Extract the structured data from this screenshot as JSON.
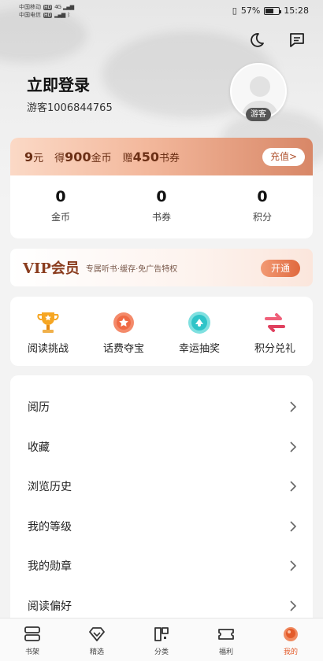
{
  "status_bar": {
    "carrier1": "中国移动",
    "carrier2": "中国电信",
    "hd": "HD",
    "signal": "4G",
    "battery": "57%",
    "time": "15:28"
  },
  "header": {
    "icons": [
      "moon-icon",
      "message-icon"
    ]
  },
  "profile": {
    "login_title": "立即登录",
    "guest_id": "游客1006844765",
    "avatar_badge": "游客"
  },
  "wallet": {
    "promo": {
      "price_num": "9",
      "price_unit": "元",
      "get_label": "得",
      "coins_num": "900",
      "coins_unit": "金币",
      "gift_label": "赠",
      "voucher_num": "450",
      "voucher_unit": "书券"
    },
    "recharge_label": "充值>",
    "stats": [
      {
        "value": "0",
        "label": "金币"
      },
      {
        "value": "0",
        "label": "书券"
      },
      {
        "value": "0",
        "label": "积分"
      }
    ]
  },
  "vip": {
    "title": "VIP会员",
    "subtitle": "专属听书·缓存·免广告特权",
    "button": "开通"
  },
  "activities": [
    {
      "label": "阅读挑战",
      "icon": "trophy-icon"
    },
    {
      "label": "话费夺宝",
      "icon": "medal-icon"
    },
    {
      "label": "幸运抽奖",
      "icon": "lottery-icon"
    },
    {
      "label": "积分兑礼",
      "icon": "exchange-icon"
    }
  ],
  "menu": [
    {
      "label": "阅历"
    },
    {
      "label": "收藏"
    },
    {
      "label": "浏览历史"
    },
    {
      "label": "我的等级"
    },
    {
      "label": "我的勋章"
    },
    {
      "label": "阅读偏好"
    }
  ],
  "nav": [
    {
      "label": "书架",
      "icon": "bookshelf-icon"
    },
    {
      "label": "精选",
      "icon": "diamond-icon"
    },
    {
      "label": "分类",
      "icon": "category-icon"
    },
    {
      "label": "福利",
      "icon": "ticket-icon"
    },
    {
      "label": "我的",
      "icon": "profile-icon"
    }
  ],
  "colors": {
    "accent": "#e35b2a",
    "promo_text": "#6b2f15",
    "vip_title": "#8a3c1e"
  }
}
